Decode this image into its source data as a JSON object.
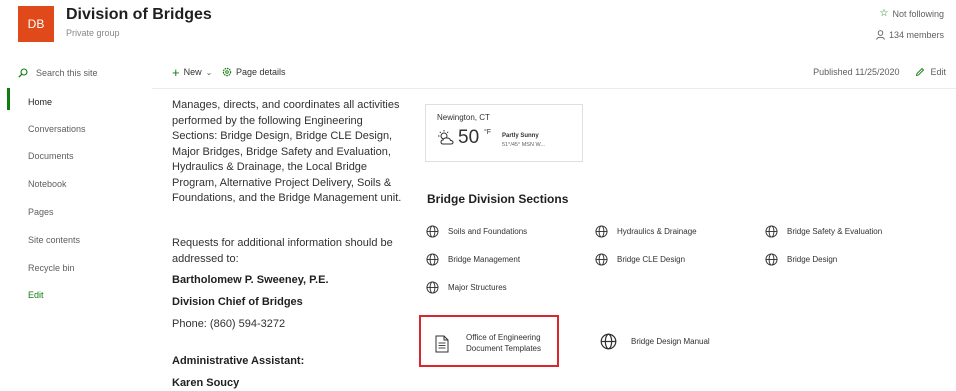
{
  "header": {
    "logo_text": "DB",
    "title": "Division of Bridges",
    "subtitle": "Private group",
    "follow_label": "Not following",
    "members_label": "134 members"
  },
  "nav": {
    "search_placeholder": "Search this site",
    "items": [
      {
        "label": "Home"
      },
      {
        "label": "Conversations"
      },
      {
        "label": "Documents"
      },
      {
        "label": "Notebook"
      },
      {
        "label": "Pages"
      },
      {
        "label": "Site contents"
      },
      {
        "label": "Recycle bin"
      },
      {
        "label": "Edit"
      }
    ]
  },
  "commandbar": {
    "new_label": "New",
    "page_details_label": "Page details",
    "published_label": "Published 11/25/2020",
    "edit_label": "Edit"
  },
  "content": {
    "description": "Manages, directs, and coordinates all activities performed by the following Engineering Sections:  Bridge Design, Bridge CLE Design, Major Bridges, Bridge Safety and Evaluation, Hydraulics & Drainage, the Local Bridge Program, Alternative Project Delivery, Soils & Foundations, and the Bridge Management unit.",
    "requests": "Requests for additional information should be addressed to:",
    "contact_name": "Bartholomew P. Sweeney, P.E.",
    "contact_title": "Division Chief of Bridges",
    "phone": "Phone: (860) 594-3272",
    "assistant_label": "Administrative Assistant:",
    "assistant_name": "Karen Soucy"
  },
  "weather": {
    "city": "Newington, CT",
    "temp": "50",
    "unit": "°F",
    "condition": "Partly Sunny",
    "detail": "51°/45°   MSN W..."
  },
  "sections": {
    "title": "Bridge Division Sections",
    "links": [
      {
        "label": "Soils and Foundations"
      },
      {
        "label": "Hydraulics & Drainage"
      },
      {
        "label": "Bridge Safety & Evaluation"
      },
      {
        "label": "Bridge Management"
      },
      {
        "label": "Bridge CLE Design"
      },
      {
        "label": "Bridge Design"
      },
      {
        "label": "Major Structures"
      }
    ],
    "quick_links": [
      {
        "label": "Office of Engineering Document Templates"
      },
      {
        "label": "Bridge Design Manual"
      }
    ]
  },
  "colors": {
    "accent": "#107c10",
    "logo_bg": "#e04a1a",
    "highlight_border": "#d9272e"
  }
}
